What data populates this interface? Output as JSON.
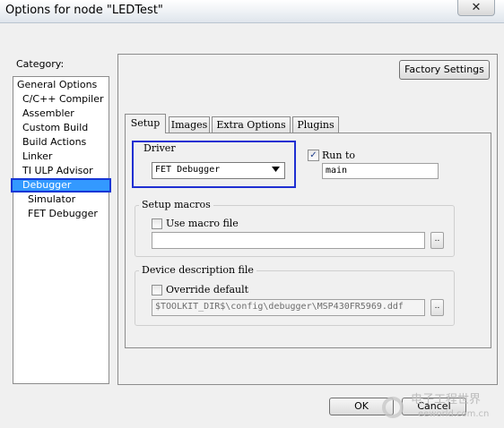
{
  "window": {
    "title": "Options for node \"LEDTest\"",
    "close_glyph": "✕"
  },
  "category": {
    "label": "Category:",
    "items": [
      "General Options",
      "C/C++ Compiler",
      "Assembler",
      "Custom Build",
      "Build Actions",
      "Linker",
      "TI ULP Advisor",
      "Debugger",
      "Simulator",
      "FET Debugger"
    ],
    "selected": "Debugger"
  },
  "factory_button": "Factory Settings",
  "tabs": [
    "Setup",
    "Images",
    "Extra Options",
    "Plugins"
  ],
  "driver": {
    "label": "Driver",
    "value": "FET Debugger"
  },
  "run_to": {
    "label": "Run to",
    "checked": true,
    "value": "main"
  },
  "setup_macros": {
    "label": "Setup macros",
    "checkbox_label": "Use macro file",
    "value": ""
  },
  "device_description": {
    "label": "Device description file",
    "checkbox_label": "Override default",
    "value": "$TOOLKIT_DIR$\\config\\debugger\\MSP430FR5969.ddf"
  },
  "browse_glyph": "..",
  "buttons": {
    "ok": "OK",
    "cancel": "Cancel"
  },
  "watermark": {
    "line1": "电子工程世界",
    "line2": "eeworld.com.cn"
  },
  "colors": {
    "selection": "#3399ff",
    "highlight_border": "#1f2fd2"
  }
}
